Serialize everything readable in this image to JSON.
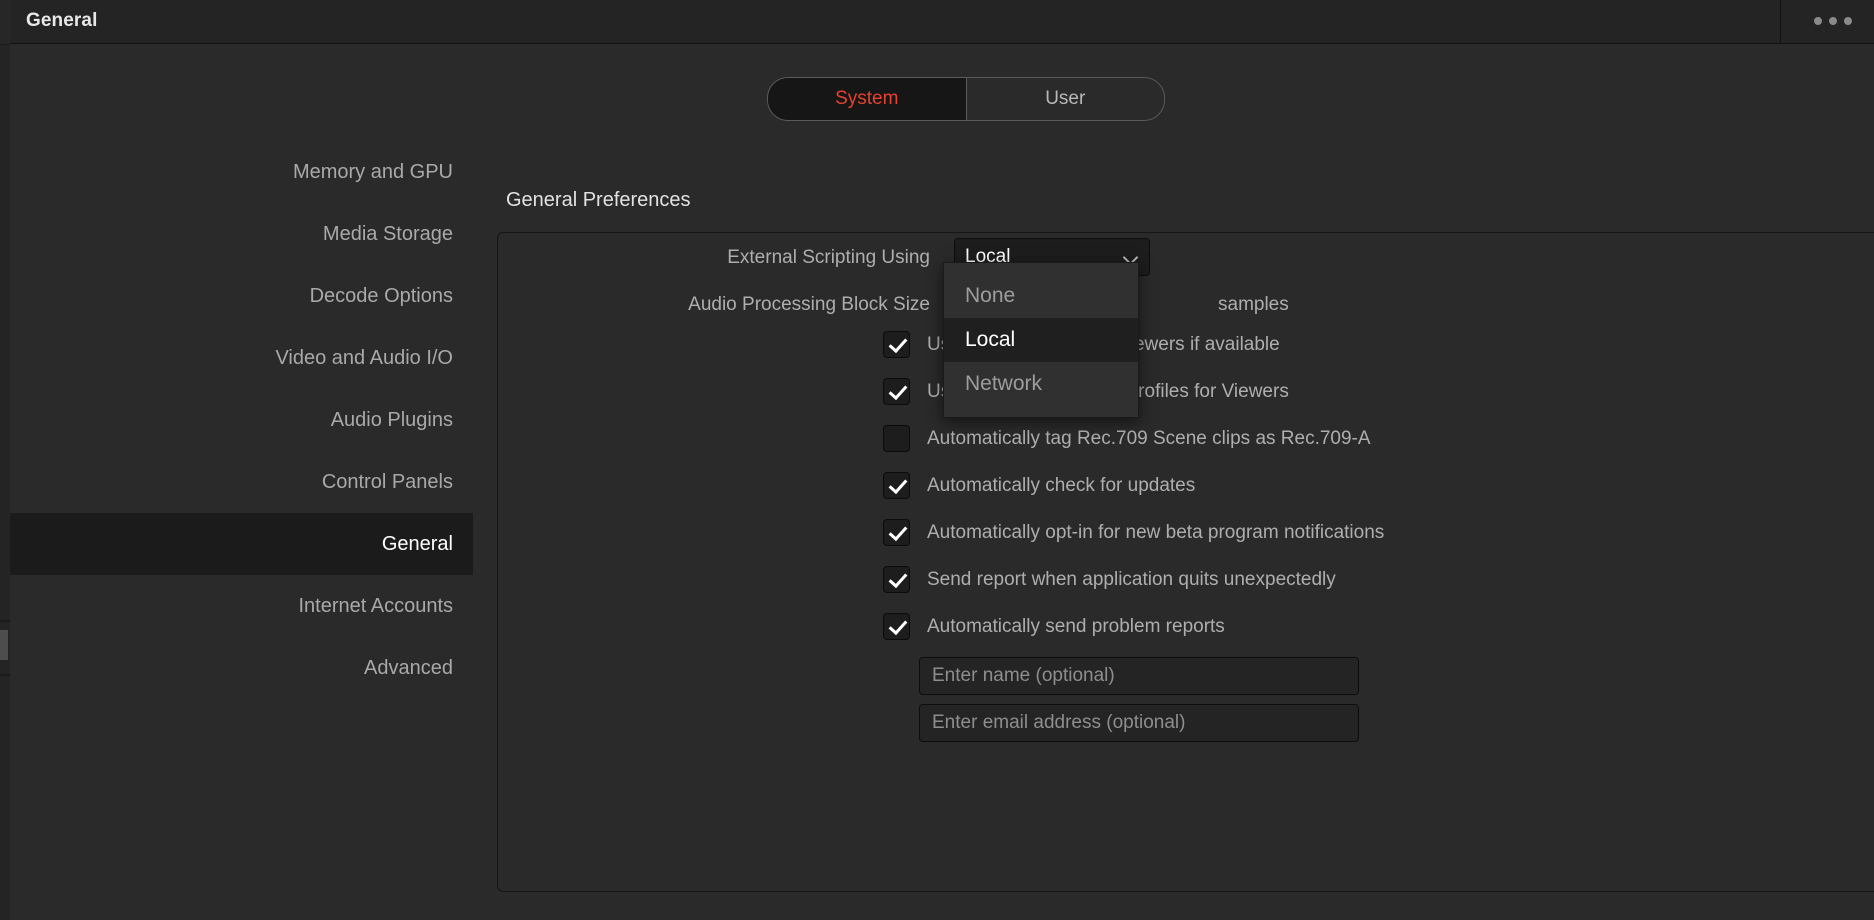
{
  "window": {
    "title": "General",
    "overflow_icon": "kebab-menu-icon"
  },
  "tabs": {
    "items": [
      {
        "label": "System",
        "active": true
      },
      {
        "label": "User",
        "active": false
      }
    ],
    "active_color": "#e8412f"
  },
  "sidebar": {
    "items": [
      {
        "label": "Memory and GPU",
        "selected": false
      },
      {
        "label": "Media Storage",
        "selected": false
      },
      {
        "label": "Decode Options",
        "selected": false
      },
      {
        "label": "Video and Audio I/O",
        "selected": false
      },
      {
        "label": "Audio Plugins",
        "selected": false
      },
      {
        "label": "Control Panels",
        "selected": false
      },
      {
        "label": "General",
        "selected": true
      },
      {
        "label": "Internet Accounts",
        "selected": false
      },
      {
        "label": "Advanced",
        "selected": false
      }
    ]
  },
  "main": {
    "heading": "General Preferences",
    "rows": [
      {
        "label": "External Scripting Using",
        "control": "select",
        "value": "Local",
        "suffix": ""
      },
      {
        "label": "Audio Processing Block Size",
        "control": "select",
        "value": "",
        "suffix": "samples"
      }
    ],
    "checkboxes": [
      {
        "label": "Use 10-bit precision in viewers if available",
        "checked": true,
        "occluded": true
      },
      {
        "label": "Use Mac Display Color Profiles for Viewers",
        "checked": true,
        "occluded": true
      },
      {
        "label": "Automatically tag Rec.709 Scene clips as Rec.709-A",
        "checked": false,
        "occluded": false
      },
      {
        "label": "Automatically check for updates",
        "checked": true,
        "occluded": false
      },
      {
        "label": "Automatically opt-in for new beta program notifications",
        "checked": true,
        "occluded": false
      },
      {
        "label": "Send report when application quits unexpectedly",
        "checked": true,
        "occluded": false
      },
      {
        "label": "Automatically send problem reports",
        "checked": true,
        "occluded": false
      }
    ],
    "inputs": [
      {
        "placeholder": "Enter name (optional)",
        "value": ""
      },
      {
        "placeholder": "Enter email address (optional)",
        "value": ""
      }
    ]
  },
  "dropdown": {
    "open": true,
    "options": [
      {
        "label": "None",
        "highlighted": false
      },
      {
        "label": "Local",
        "highlighted": true
      },
      {
        "label": "Network",
        "highlighted": false
      }
    ]
  }
}
